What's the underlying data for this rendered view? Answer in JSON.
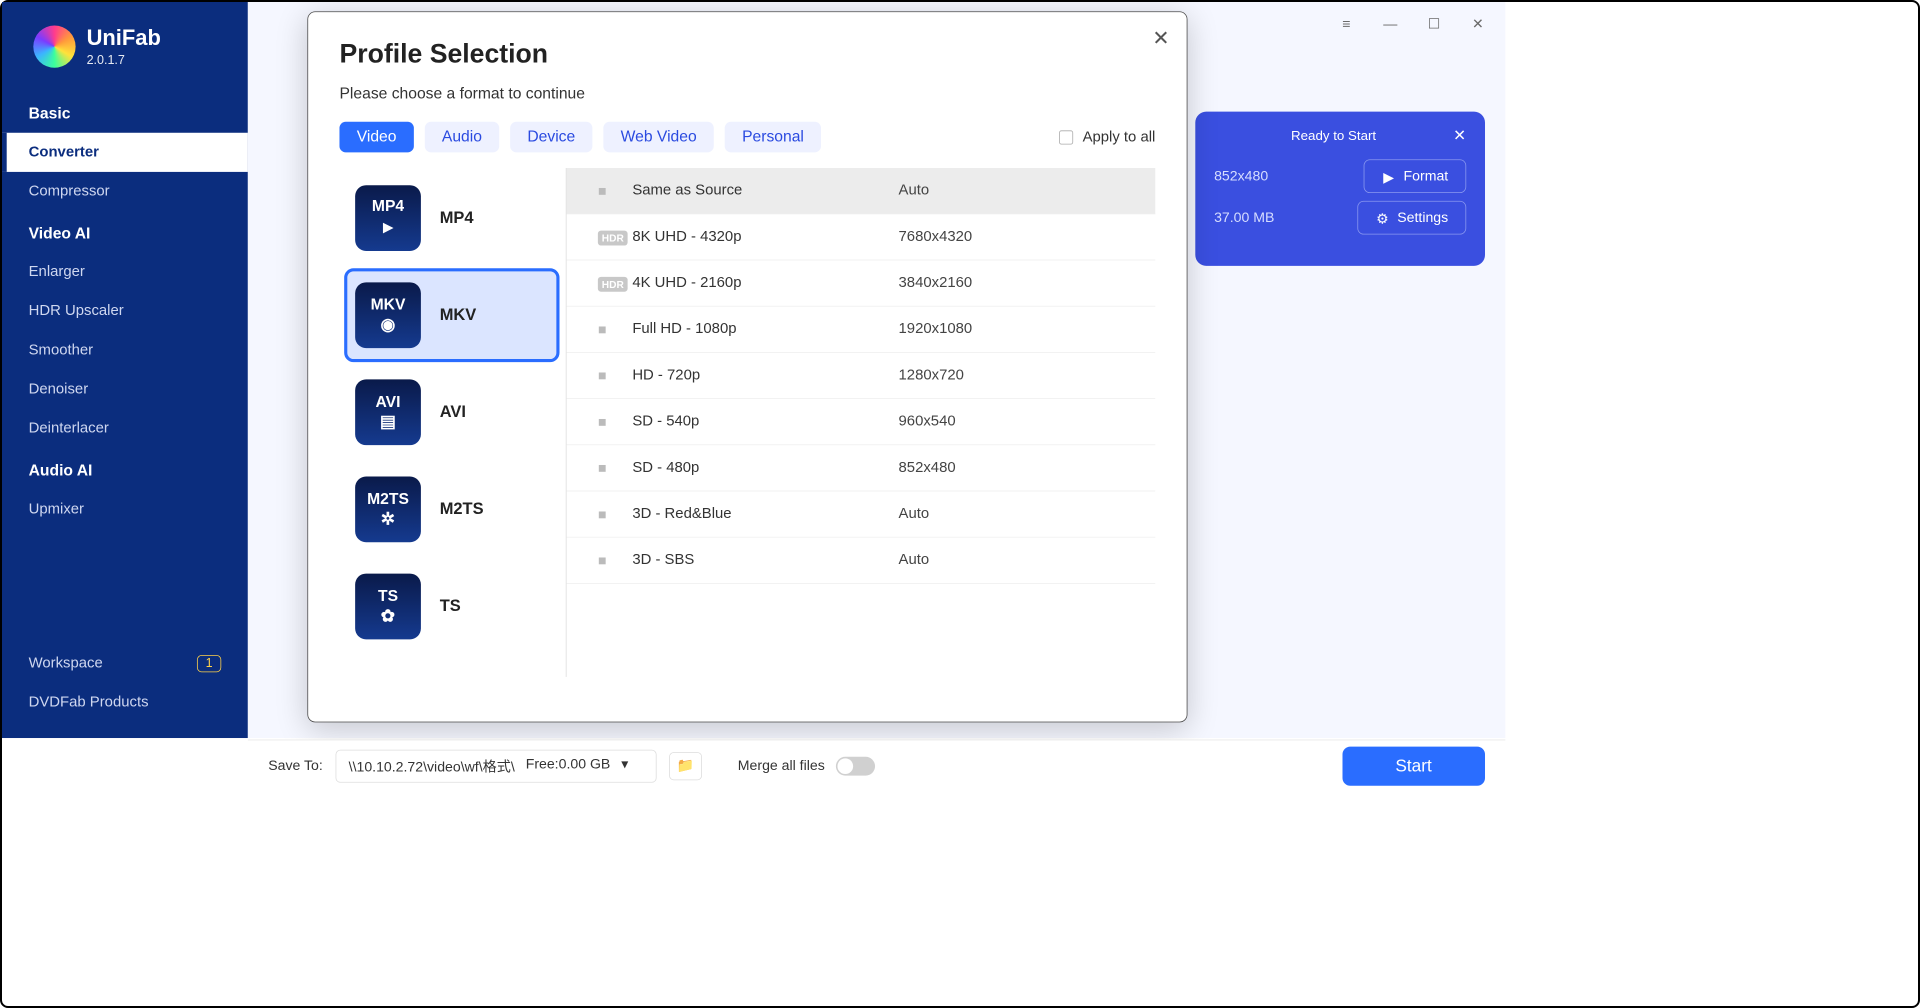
{
  "app": {
    "name": "UniFab",
    "version": "2.0.1.7"
  },
  "sidebar": {
    "groups": [
      {
        "header": "Basic",
        "items": [
          "Converter",
          "Compressor"
        ]
      },
      {
        "header": "Video AI",
        "items": [
          "Enlarger",
          "HDR Upscaler",
          "Smoother",
          "Denoiser",
          "Deinterlacer"
        ]
      },
      {
        "header": "Audio AI",
        "items": [
          "Upmixer"
        ]
      }
    ],
    "workspace": {
      "label": "Workspace",
      "badge": "1"
    },
    "dvdfab": "DVDFab Products"
  },
  "panel": {
    "ready": "Ready to Start",
    "res": "852x480",
    "size": "37.00 MB",
    "format_btn": "Format",
    "settings_btn": "Settings"
  },
  "modal": {
    "title": "Profile Selection",
    "subtitle": "Please choose a format to continue",
    "tabs": [
      "Video",
      "Audio",
      "Device",
      "Web Video",
      "Personal"
    ],
    "apply": "Apply to all",
    "formats": [
      "MP4",
      "MKV",
      "AVI",
      "M2TS",
      "TS"
    ],
    "resolutions": [
      {
        "name": "Same as Source",
        "val": "Auto",
        "icon": "video"
      },
      {
        "name": "8K UHD - 4320p",
        "val": "7680x4320",
        "icon": "hdr"
      },
      {
        "name": "4K UHD - 2160p",
        "val": "3840x2160",
        "icon": "hdr"
      },
      {
        "name": "Full HD - 1080p",
        "val": "1920x1080",
        "icon": "video"
      },
      {
        "name": "HD - 720p",
        "val": "1280x720",
        "icon": "video"
      },
      {
        "name": "SD - 540p",
        "val": "960x540",
        "icon": "video"
      },
      {
        "name": "SD - 480p",
        "val": "852x480",
        "icon": "video"
      },
      {
        "name": "3D - Red&Blue",
        "val": "Auto",
        "icon": "video"
      },
      {
        "name": "3D - SBS",
        "val": "Auto",
        "icon": "video"
      }
    ]
  },
  "bottom": {
    "save_to": "Save To:",
    "path": "\\\\10.10.2.72\\video\\wf\\格式\\",
    "free": "Free:0.00 GB",
    "merge": "Merge all files",
    "start": "Start"
  }
}
